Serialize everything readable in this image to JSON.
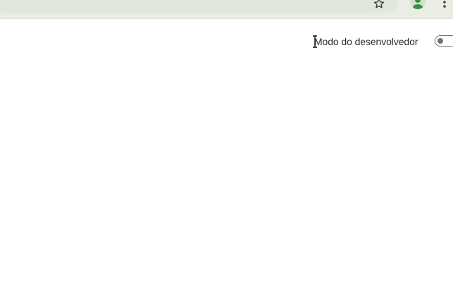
{
  "toolbar": {
    "icons": [
      "star-icon",
      "profile-icon",
      "more-menu-icon"
    ]
  },
  "extensions_header": {
    "developer_mode_label": "Modo do desenvolvedor",
    "developer_mode_enabled": false
  },
  "colors": {
    "toolbar_bg": "#e9ede4",
    "omnibox_bg": "#e1e7db",
    "profile_accent": "#3d8b3d",
    "toggle_outline": "#6f736e"
  }
}
